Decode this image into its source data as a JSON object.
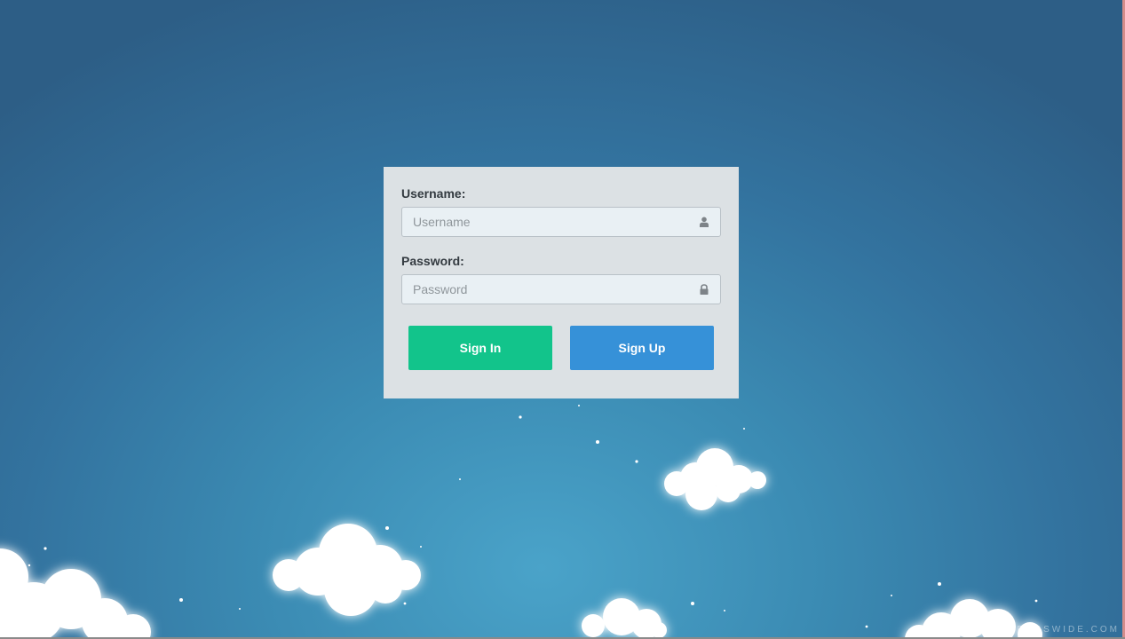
{
  "login_form": {
    "username_label": "Username:",
    "username_placeholder": "Username",
    "username_value": "",
    "username_icon": "user-icon",
    "password_label": "Password:",
    "password_placeholder": "Password",
    "password_value": "",
    "password_icon": "lock-icon",
    "sign_in_label": "Sign In",
    "sign_up_label": "Sign Up"
  },
  "background": {
    "watermark_text": "WALLPAPERSWIDE.COM",
    "theme": "sky-clouds-stars"
  },
  "colors": {
    "card_background": "#dce1e4",
    "input_background": "#e9f0f4",
    "sign_in": "#12c48b",
    "sign_up": "#3691d8",
    "sky_light": "#4aa3c9",
    "sky_dark": "#2d5e86"
  }
}
